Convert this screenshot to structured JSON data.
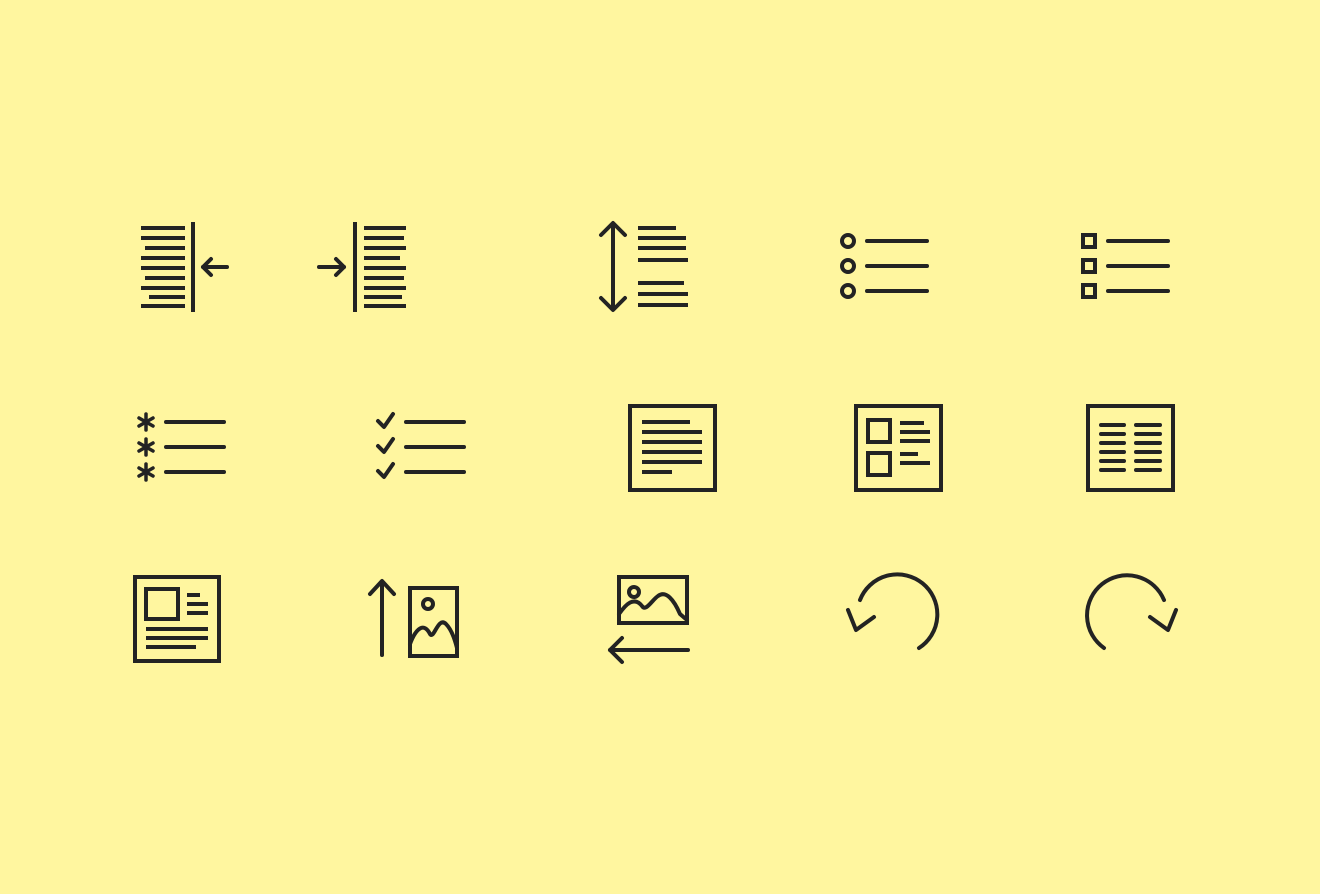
{
  "colors": {
    "background": "#fff69f",
    "icon_stroke": "#232323"
  },
  "icons": [
    "align-right-indent-in-icon",
    "align-left-indent-in-icon",
    "line-height-icon",
    "bulleted-list-circle-icon",
    "bulleted-list-square-icon",
    "bulleted-list-asterisk-icon",
    "checklist-icon",
    "text-block-icon",
    "layout-two-images-text-icon",
    "two-column-text-icon",
    "article-layout-icon",
    "image-upload-arrow-icon",
    "image-wrap-arrow-icon",
    "undo-icon",
    "redo-icon"
  ]
}
